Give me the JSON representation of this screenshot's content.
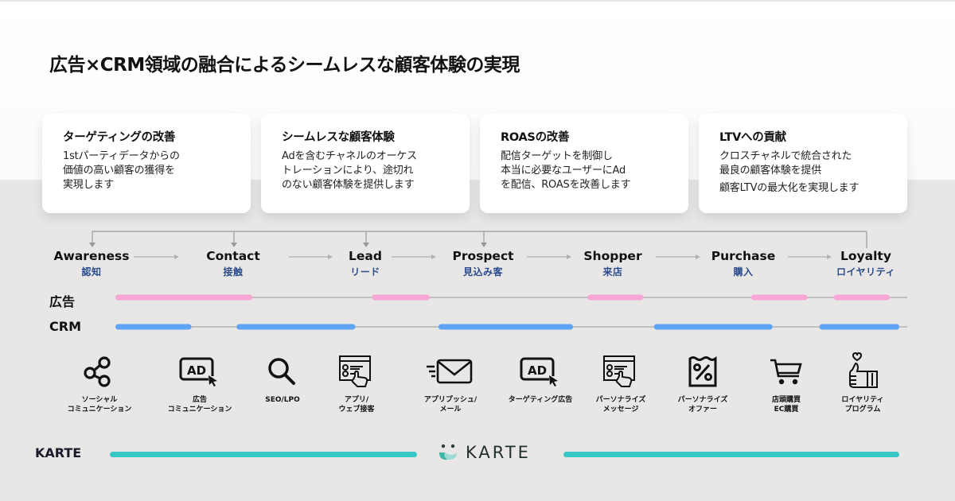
{
  "title": "広告×CRM領域の融合によるシームレスな顧客体験の実現",
  "cards": [
    {
      "heading": "ターゲティングの改善",
      "body": "1stパーティデータからの\n価値の高い顧客の獲得を\n実現します",
      "extra": ""
    },
    {
      "heading": "シームレスな顧客体験",
      "body": "Adを含むチャネルのオーケス\nトレーションにより、途切れ\nのない顧客体験を提供します",
      "extra": ""
    },
    {
      "heading": "ROASの改善",
      "body": "配信ターゲットを制御し\n本当に必要なユーザーにAd\nを配信、ROASを改善します",
      "extra": ""
    },
    {
      "heading": "LTVへの貢献",
      "body": "クロスチャネルで統合された\n最良の顧客体験を提供",
      "extra": "顧客LTVの最大化を実現します"
    }
  ],
  "stages": [
    {
      "en": "Awareness",
      "jp": "認知"
    },
    {
      "en": "Contact",
      "jp": "接触"
    },
    {
      "en": "Lead",
      "jp": "リード"
    },
    {
      "en": "Prospect",
      "jp": "見込み客"
    },
    {
      "en": "Shopper",
      "jp": "来店"
    },
    {
      "en": "Purchase",
      "jp": "購入"
    },
    {
      "en": "Loyalty",
      "jp": "ロイヤリティ"
    }
  ],
  "rows": {
    "ad": {
      "label": "広告",
      "color": "#f7a6d6",
      "segments": [
        [
          0.0,
          0.173
        ],
        [
          0.324,
          0.397
        ],
        [
          0.596,
          0.667
        ],
        [
          0.803,
          0.874
        ],
        [
          0.907,
          0.978
        ]
      ]
    },
    "crm": {
      "label": "CRM",
      "color": "#5fa3f5",
      "segments": [
        [
          0.0,
          0.096
        ],
        [
          0.153,
          0.303
        ],
        [
          0.408,
          0.578
        ],
        [
          0.68,
          0.83
        ],
        [
          0.889,
          0.99
        ]
      ]
    }
  },
  "channels": [
    {
      "icon": "share-icon",
      "label": "ソーシャル\nコミュニケーション"
    },
    {
      "icon": "ad-click-icon",
      "label": "広告\nコミュニケーション"
    },
    {
      "icon": "search-icon",
      "label": "SEO/LPO"
    },
    {
      "icon": "web-form-hand-icon",
      "label": "アプリ/\nウェブ接客"
    },
    {
      "icon": "mail-send-icon",
      "label": "アプリプッシュ/\nメール"
    },
    {
      "icon": "ad-click-icon",
      "label": "ターゲティング広告"
    },
    {
      "icon": "web-form-hand-icon",
      "label": "パーソナライズ\nメッセージ"
    },
    {
      "icon": "percent-receipt-icon",
      "label": "パーソナライズ\nオファー"
    },
    {
      "icon": "cart-icon",
      "label": "店頭購買\nEC購買"
    },
    {
      "icon": "thumbs-up-heart-icon",
      "label": "ロイヤリティ\nプログラム"
    }
  ],
  "karte": {
    "label": "KARTE",
    "logo_text": "KARTE",
    "color": "#38c6c6"
  }
}
